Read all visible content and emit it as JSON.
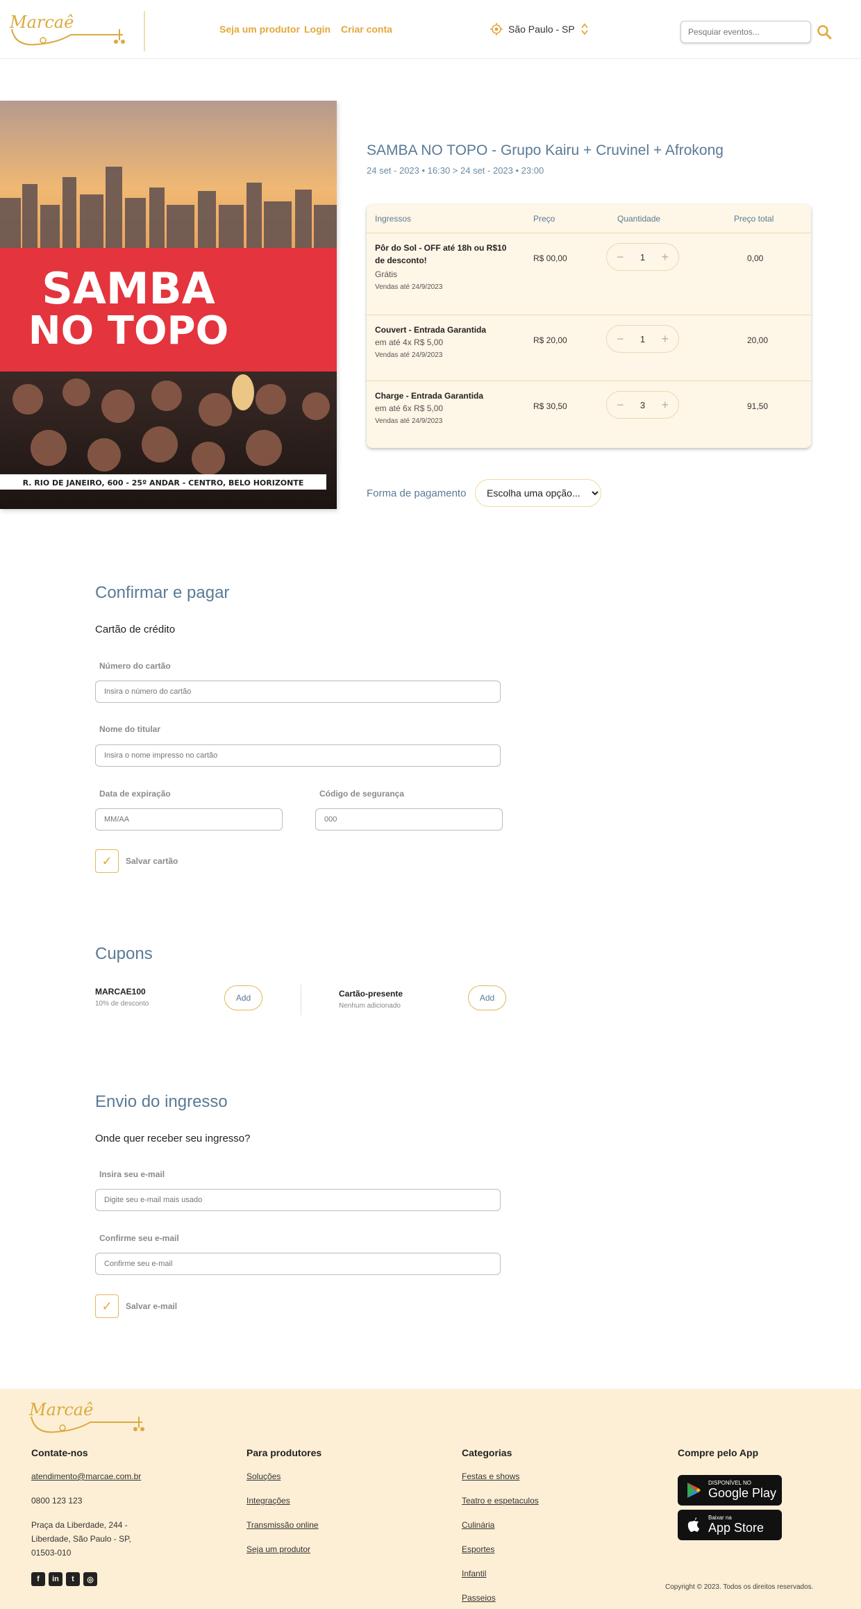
{
  "header": {
    "logo_text": "Marcaê",
    "nav": {
      "producer": "Seja um produtor",
      "login": "Login",
      "signup": "Criar conta"
    },
    "city": "São Paulo - SP",
    "search_placeholder": "Pesquiar eventos...",
    "icons": [
      "location-icon",
      "chevron-updown-icon",
      "search-icon"
    ]
  },
  "banner": {
    "headline_1": "SAMBA",
    "headline_2": "NO TOPO",
    "address": "R. RIO DE JANEIRO, 600 - 25º ANDAR - CENTRO, BELO HORIZONTE"
  },
  "event": {
    "title": "SAMBA NO TOPO - Grupo Kairu + Cruvinel + Afrokong",
    "date": "24 set - 2023 • 16:30 > 24 set - 2023 • 23:00"
  },
  "tickets": {
    "headers": {
      "name": "Ingressos",
      "price": "Preço",
      "quantity": "Quantidade",
      "total": "Preço total"
    },
    "rows": [
      {
        "name": "Pôr do Sol - OFF até 18h ou R$10 de desconto!",
        "sub": "Grátis",
        "sales": "Vendas até 24/9/2023",
        "price": "R$ 00,00",
        "qty": "1",
        "total": "0,00"
      },
      {
        "name": "Couvert - Entrada Garantida",
        "sub": "em até 4x R$ 5,00",
        "sales": "Vendas até 24/9/2023",
        "price": "R$ 20,00",
        "qty": "1",
        "total": "20,00"
      },
      {
        "name": "Charge - Entrada Garantida",
        "sub": "em até 6x R$ 5,00",
        "sales": "Vendas até 24/9/2023",
        "price": "R$ 30,50",
        "qty": "3",
        "total": "91,50"
      }
    ],
    "minus": "−",
    "plus": "+"
  },
  "payment": {
    "label": "Forma de pagamento",
    "select_value": "Escolha uma opção..."
  },
  "confirm": {
    "title": "Confirmar e pagar",
    "subtitle": "Cartão de crédito",
    "card_number_label": "Número do cartão",
    "card_number_placeholder": "Insira o número do cartão",
    "holder_label": "Nome do titular",
    "holder_placeholder": "Insira o nome impresso no cartão",
    "expiry_label": "Data de expiração",
    "expiry_placeholder": "MM/AA",
    "cvv_label": "Código de segurança",
    "cvv_placeholder": "000",
    "save_card": "Salvar cartão",
    "check_mark": "✓"
  },
  "coupons": {
    "title": "Cupons",
    "coupon_name": "MARCAE100",
    "coupon_sub": "10% de desconto",
    "gift_name": "Cartão-presente",
    "gift_sub": "Nenhum adicionado",
    "add_label": "Add"
  },
  "delivery": {
    "title": "Envio do ingresso",
    "subtitle": "Onde quer receber seu ingresso?",
    "email_label": "Insira seu e-mail",
    "email_placeholder": "Digite seu e-mail mais usado",
    "confirm_label": "Confirme seu e-mail",
    "confirm_placeholder": "Confirme seu e-mail",
    "save_email": "Salvar e-mail",
    "check_mark": "✓"
  },
  "footer": {
    "contact_title": "Contate-nos",
    "email": "atendimento@marcae.com.br",
    "phone": "0800 123 123",
    "address": "Praça da Liberdade, 244 - Liberdade, São Paulo - SP, 01503-010",
    "producers_title": "Para produtores",
    "producers_links": [
      "Soluções",
      "Integrações",
      "Transmissão online",
      "Seja um produtor"
    ],
    "categories_title": "Categorias",
    "categories_links": [
      "Festas e shows",
      "Teatro e espetaculos",
      "Culinária",
      "Esportes",
      "Infantil",
      "Passeios"
    ],
    "app_title": "Compre pelo App",
    "google_small": "DISPONÍVEL NO",
    "google_big": "Google Play",
    "apple_small": "Baixar na",
    "apple_big": "App Store",
    "copyright": "Copyright © 2023. Todos os direitos reservados.",
    "social_icons": [
      "facebook-icon",
      "linkedin-icon",
      "twitter-icon",
      "instagram-icon"
    ],
    "social_glyphs": [
      "f",
      "in",
      "t",
      "◎"
    ]
  },
  "colors": {
    "accent": "#e3a83c",
    "heading": "#5a7a96",
    "footer_bg": "#fdefd5",
    "table_bg": "#fef6e6",
    "banner_red": "#e4343d"
  }
}
